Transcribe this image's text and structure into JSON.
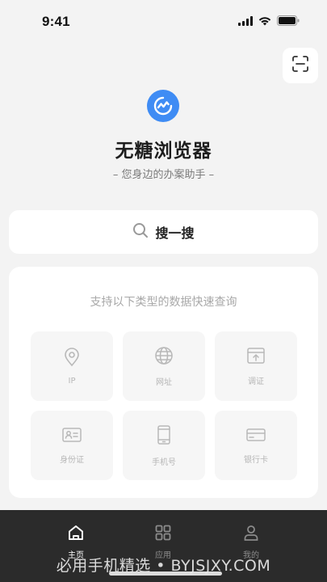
{
  "status_bar": {
    "time": "9:41"
  },
  "header": {
    "scan_icon": "scan-icon"
  },
  "hero": {
    "logo_icon": "browser-logo-icon",
    "title": "无糖浏览器",
    "subtitle": "– 您身边的办案助手 –"
  },
  "search": {
    "label": "搜一搜",
    "icon": "search-icon"
  },
  "query_types": {
    "title": "支持以下类型的数据快速查询",
    "items": [
      {
        "label": "IP",
        "icon": "location-pin-icon"
      },
      {
        "label": "网址",
        "icon": "globe-icon"
      },
      {
        "label": "调证",
        "icon": "upload-box-icon"
      },
      {
        "label": "身份证",
        "icon": "id-card-icon"
      },
      {
        "label": "手机号",
        "icon": "phone-icon"
      },
      {
        "label": "银行卡",
        "icon": "bank-card-icon"
      }
    ]
  },
  "tabs": [
    {
      "label": "主页",
      "icon": "home-icon",
      "active": true
    },
    {
      "label": "应用",
      "icon": "apps-grid-icon",
      "active": false
    },
    {
      "label": "我的",
      "icon": "user-icon",
      "active": false
    }
  ],
  "watermark": "必用手机精选 • BYJSJXY.COM",
  "colors": {
    "accent": "#3f8cf4",
    "background": "#f3f3f3",
    "tab_bar": "#2b2b2b"
  }
}
